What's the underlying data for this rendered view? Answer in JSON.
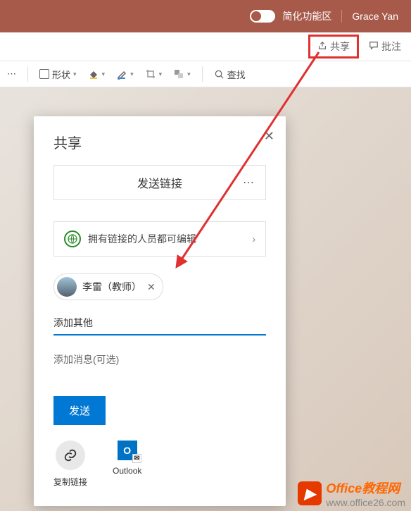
{
  "title_bar": {
    "toggle_label": "简化功能区",
    "user_name": "Grace Yan"
  },
  "commands": {
    "share_label": "共享",
    "comments_label": "批注"
  },
  "ribbon": {
    "shapes_label": "形状",
    "find_label": "查找"
  },
  "share_pane": {
    "title": "共享",
    "send_link": "发送链接",
    "permission_text": "拥有链接的人员都可编辑",
    "recipient_name": "李雷（教师）",
    "add_other": "添加其他",
    "add_message": "添加消息(可选)",
    "send_button": "发送",
    "copy_link": "复制链接",
    "outlook": "Outlook"
  },
  "watermark": {
    "brand": "Office教程网",
    "url": "www.office26.com"
  }
}
